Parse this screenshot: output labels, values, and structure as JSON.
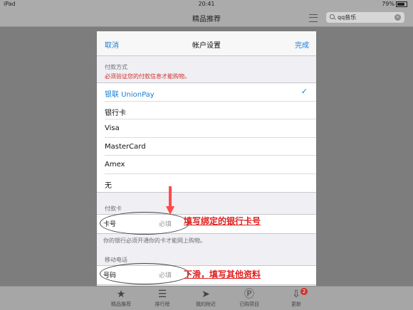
{
  "status": {
    "device": "iPad",
    "time": "20:41",
    "battery": "79%"
  },
  "navbar": {
    "title": "精品推荐",
    "search_value": "qq音乐"
  },
  "tabs": [
    {
      "label": "精品推荐",
      "icon": "star-icon"
    },
    {
      "label": "排行榜",
      "icon": "list-icon"
    },
    {
      "label": "我的附近",
      "icon": "location-icon"
    },
    {
      "label": "已购项目",
      "icon": "purchased-icon"
    },
    {
      "label": "更新",
      "icon": "update-icon",
      "badge": "2"
    }
  ],
  "modal": {
    "cancel": "取消",
    "title": "帐户设置",
    "done": "完成",
    "payment_label": "付款方式",
    "payment_warning": "必须验证您的付款信息才能购物。",
    "options": [
      "银联 UnionPay",
      "银行卡",
      "Visa",
      "MasterCard",
      "Amex",
      "无"
    ],
    "selected_option": "银联 UnionPay",
    "card_section_label": "付款卡",
    "card_field_label": "卡号",
    "card_field_placeholder": "必填",
    "card_note": "你的银行必须开通你的卡才能网上购物。",
    "phone_section_label": "移动电话",
    "phone_field_label": "号码",
    "phone_field_placeholder": "必填"
  },
  "annotations": {
    "card_callout": "填写绑定的银行卡号",
    "phone_callout": "下滑，填写其他资料",
    "arrow_color": "#ff4a4a",
    "callout_color": "#e12020"
  }
}
